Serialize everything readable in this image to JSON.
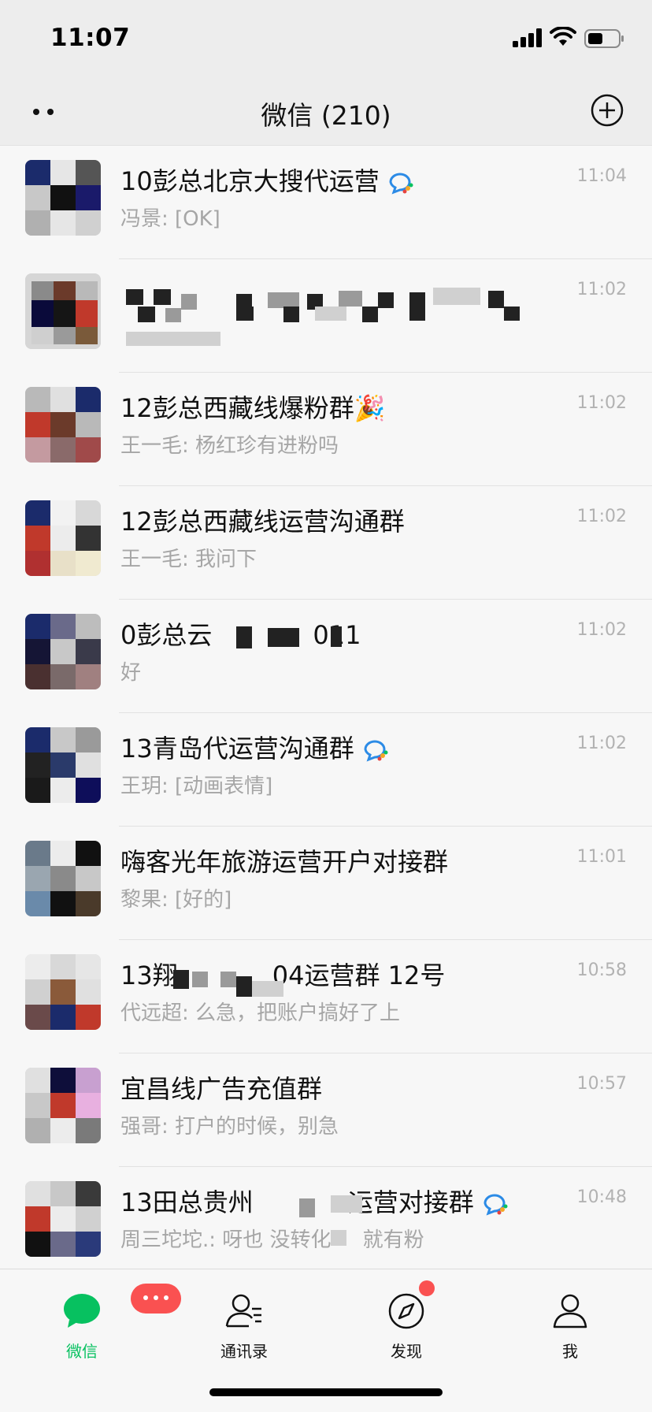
{
  "status_bar": {
    "time": "11:07"
  },
  "nav": {
    "title": "微信 (210)"
  },
  "chats": [
    {
      "title": "10彭总北京大搜代运营",
      "preview": "冯景: [OK]",
      "time": "11:04",
      "badge_icon": "wecom-icon"
    },
    {
      "title": "",
      "preview": "",
      "time": "11:02",
      "badge_icon": ""
    },
    {
      "title": "12彭总西藏线爆粉群🎉",
      "preview": "王一毛: 杨红珍有进粉吗",
      "time": "11:02",
      "badge_icon": ""
    },
    {
      "title": "12彭总西藏线运营沟通群",
      "preview": "王一毛: 我问下",
      "time": "11:02",
      "badge_icon": ""
    },
    {
      "title": "0彭总云",
      "preview": "好",
      "time": "11:02",
      "badge_icon": ""
    },
    {
      "title": "13青岛代运营沟通群",
      "preview": "王玥: [动画表情]",
      "time": "11:02",
      "badge_icon": "wecom-icon"
    },
    {
      "title": "嗨客光年旅游运营开户对接群",
      "preview": "黎果: [好的]",
      "time": "11:01",
      "badge_icon": ""
    },
    {
      "title": "13翔",
      "preview": "代远超: 么急，把账户搞好了上",
      "time": "10:58",
      "badge_icon": ""
    },
    {
      "title": "宜昌线广告充值群",
      "preview": "强哥: 打户的时候，别急",
      "time": "10:57",
      "badge_icon": ""
    },
    {
      "title": "13田总贵州",
      "preview": "周三坨坨.: 呀也 没转化",
      "time": "10:48",
      "badge_icon": "wecom-icon"
    }
  ],
  "chat_title_suffix": {
    "4": "011",
    "7": "04运营群 12号",
    "9": "运营对接群"
  },
  "chat_preview_suffix": {
    "9": "就有粉"
  },
  "tabs": [
    {
      "label": "微信",
      "icon": "chat-bubble-icon",
      "active": true
    },
    {
      "label": "通讯录",
      "icon": "contacts-icon",
      "active": false
    },
    {
      "label": "发现",
      "icon": "compass-icon",
      "active": false
    },
    {
      "label": "我",
      "icon": "person-icon",
      "active": false
    }
  ],
  "colors": {
    "accent": "#07c160",
    "badge_red": "#fa5151",
    "bg": "#ededed",
    "list_bg": "#f7f7f7"
  }
}
